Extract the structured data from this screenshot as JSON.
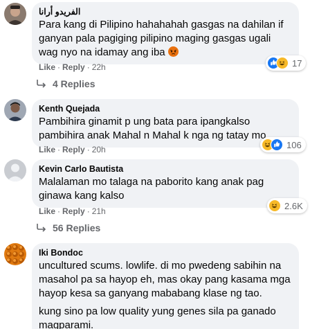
{
  "comments": [
    {
      "author": "الفريدو أرانا",
      "lines": [
        "Para kang di Pilipino hahahahah gasgas na dahilan if ganyan pala pagiging pilipino maging gasgas ugali wag nyo na idamay ang iba"
      ],
      "like": "Like",
      "reply": "Reply",
      "time": "22h",
      "reaction_icons": [
        "like-icon",
        "haha-icon"
      ],
      "reaction_count": "17",
      "replies": "4 Replies"
    },
    {
      "author": "Kenth Quejada",
      "lines": [
        "Pambihira ginamit p ung bata para ipangkalso pambihira anak Mahal n Mahal k nga ng tatay mo"
      ],
      "like": "Like",
      "reply": "Reply",
      "time": "20h",
      "reaction_icons": [
        "haha-icon",
        "like-icon"
      ],
      "reaction_count": "106"
    },
    {
      "author": "Kevin Carlo Bautista",
      "lines": [
        "Malalaman mo talaga na paborito kang anak pag ginawa kang kalso"
      ],
      "like": "Like",
      "reply": "Reply",
      "time": "21h",
      "reaction_icons": [
        "haha-icon"
      ],
      "reaction_count": "2.6K",
      "replies": "56 Replies"
    },
    {
      "author": "Iki Bondoc",
      "lines": [
        "uncultured scums. lowlife. di mo pwedeng sabihin na masahol pa sa hayop eh, mas okay pang kasama mga hayop kesa sa ganyang mababang klase ng tao.",
        "kung sino pa low quality yung genes sila pa ganado magparami."
      ]
    }
  ],
  "colors": {
    "bubble": "#f0f2f5",
    "meta": "#65676b",
    "like_blue": "#1877f2",
    "haha_yellow": "#f7b928"
  }
}
